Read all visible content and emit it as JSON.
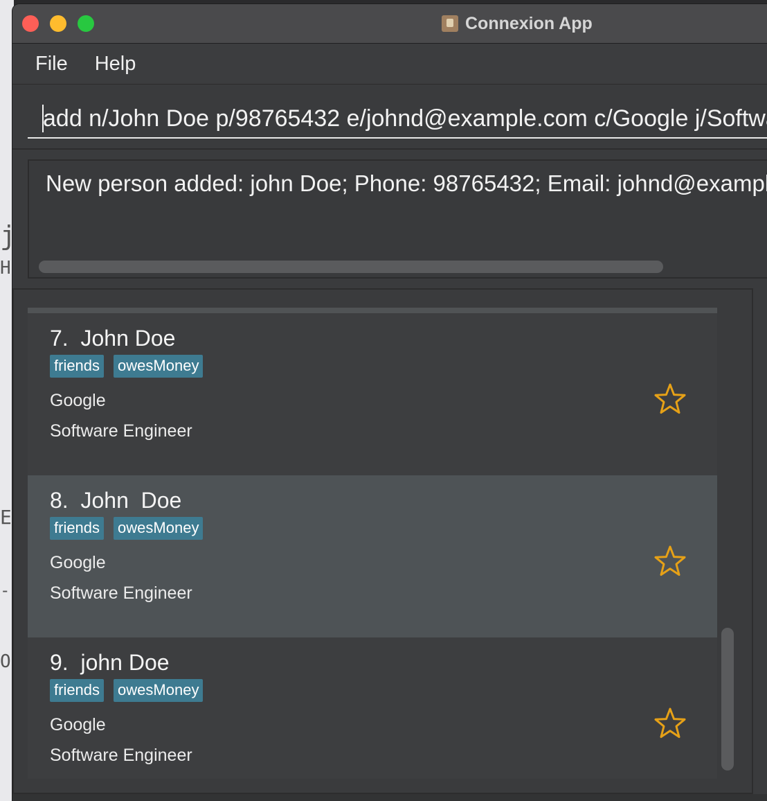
{
  "window": {
    "title": "Connexion App"
  },
  "menu": {
    "file_label": "File",
    "help_label": "Help"
  },
  "command_box": {
    "value": "add n/John Doe p/98765432 e/johnd@example.com c/Google j/Software Engineer"
  },
  "result_display": {
    "text": "New person added: john Doe; Phone: 98765432; Email: johnd@example.com"
  },
  "background_fragments": {
    "frag1": "j",
    "frag2": "Ha",
    "frag3": "E",
    "frag4": "-",
    "frag5": "OR"
  },
  "persons": [
    {
      "index_name": "7.  John Doe",
      "tags": [
        "friends",
        "owesMoney"
      ],
      "company": "Google",
      "job": "Software Engineer",
      "starred": false
    },
    {
      "index_name": "8.  John  Doe",
      "tags": [
        "friends",
        "owesMoney"
      ],
      "company": "Google",
      "job": "Software Engineer",
      "starred": false
    },
    {
      "index_name": "9.  john Doe",
      "tags": [
        "friends",
        "owesMoney"
      ],
      "company": "Google",
      "job": "Software Engineer",
      "starred": false
    }
  ],
  "colors": {
    "tag_background": "#3e7b91",
    "star_outline": "#e6a117",
    "selected_card": "#4e5356"
  }
}
